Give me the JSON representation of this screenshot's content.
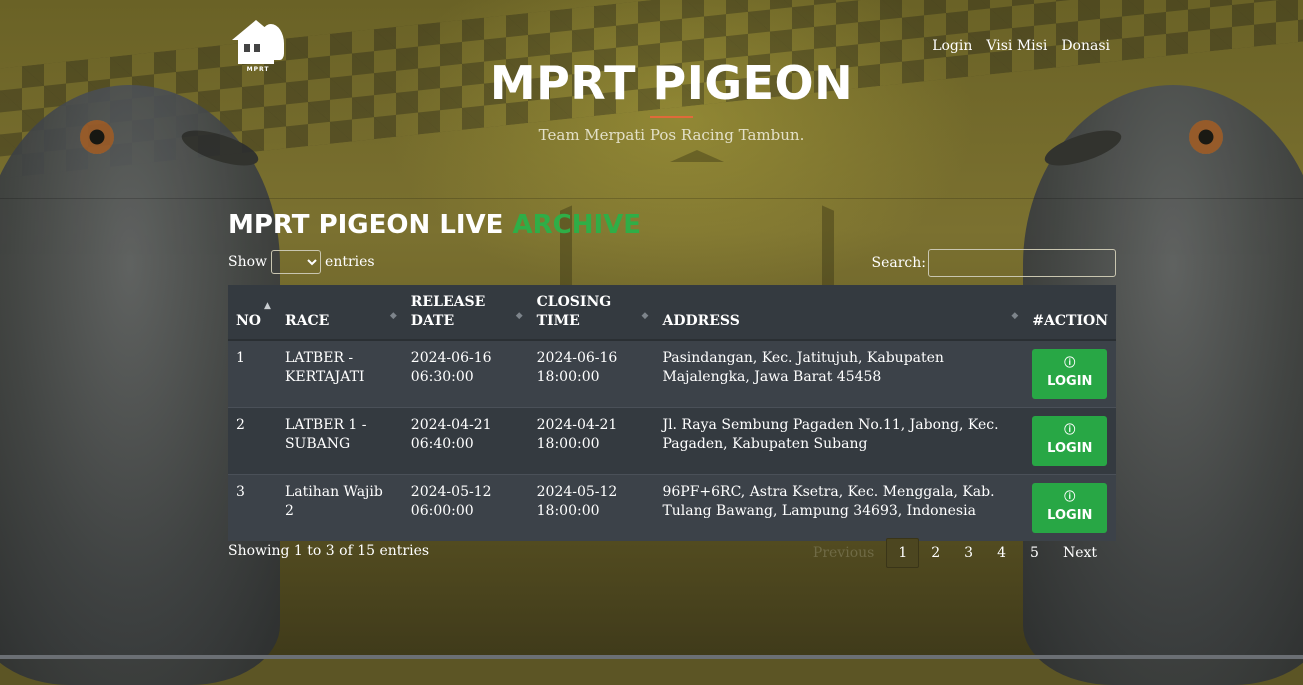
{
  "header": {
    "logo_text": "MPRT",
    "nav": [
      "Login",
      "Visi Misi",
      "Donasi"
    ],
    "title": "MPRT PIGEON",
    "tagline": "Team Merpati Pos Racing Tambun."
  },
  "section": {
    "title_main": "MPRT PIGEON LIVE",
    "title_accent": "ARCHIVE"
  },
  "controls": {
    "show_label": "Show",
    "entries_label": "entries",
    "search_label": "Search:",
    "search_value": ""
  },
  "table": {
    "headers": [
      "NO",
      "RACE",
      "RELEASE DATE",
      "CLOSING TIME",
      "ADDRESS",
      "#ACTION"
    ],
    "rows": [
      {
        "no": "1",
        "race": "LATBER - KERTAJATI",
        "release": "2024-06-16 06:30:00",
        "closing": "2024-06-16 18:00:00",
        "address": "Pasindangan, Kec. Jatitujuh, Kabupaten Majalengka, Jawa Barat 45458",
        "action": "LOGIN"
      },
      {
        "no": "2",
        "race": "LATBER 1 - SUBANG",
        "release": "2024-04-21 06:40:00",
        "closing": "2024-04-21 18:00:00",
        "address": "Jl. Raya Sembung Pagaden No.11, Jabong, Kec. Pagaden, Kabupaten Subang",
        "action": "LOGIN"
      },
      {
        "no": "3",
        "race": "Latihan Wajib 2",
        "release": "2024-05-12 06:00:00",
        "closing": "2024-05-12 18:00:00",
        "address": "96PF+6RC, Astra Ksetra, Kec. Menggala, Kab. Tulang Bawang, Lampung 34693, Indonesia",
        "action": "LOGIN"
      }
    ]
  },
  "footer": {
    "info": "Showing 1 to 3 of 15 entries",
    "previous": "Previous",
    "pages": [
      "1",
      "2",
      "3",
      "4",
      "5"
    ],
    "next": "Next"
  },
  "colors": {
    "accent_green": "#2fae47",
    "button_green": "#28a745",
    "table_dark": "#343a40",
    "title_rule": "#e06a3a"
  }
}
